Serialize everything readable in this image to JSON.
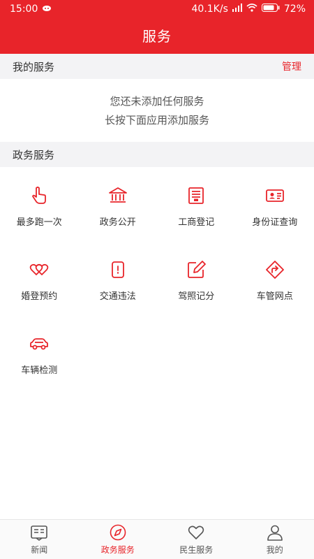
{
  "status": {
    "time": "15:00",
    "speed": "40.1K/s",
    "battery": "72%"
  },
  "header": {
    "title": "服务"
  },
  "my_services": {
    "title": "我的服务",
    "manage": "管理",
    "empty_line1": "您还未添加任何服务",
    "empty_line2": "长按下面应用添加服务"
  },
  "gov_services": {
    "title": "政务服务",
    "items": [
      {
        "label": "最多跑一次",
        "icon": "hand-pointer-icon"
      },
      {
        "label": "政务公开",
        "icon": "government-building-icon"
      },
      {
        "label": "工商登记",
        "icon": "business-license-icon"
      },
      {
        "label": "身份证查询",
        "icon": "id-card-icon"
      },
      {
        "label": "婚登预约",
        "icon": "linked-hearts-icon"
      },
      {
        "label": "交通违法",
        "icon": "traffic-violation-icon"
      },
      {
        "label": "驾照记分",
        "icon": "edit-pen-icon"
      },
      {
        "label": "车管网点",
        "icon": "direction-sign-icon"
      },
      {
        "label": "车辆检测",
        "icon": "car-icon"
      }
    ]
  },
  "tabs": [
    {
      "label": "新闻",
      "icon": "newspaper-icon"
    },
    {
      "label": "政务服务",
      "icon": "compass-icon",
      "active": true
    },
    {
      "label": "民生服务",
      "icon": "heart-icon"
    },
    {
      "label": "我的",
      "icon": "user-icon"
    }
  ],
  "colors": {
    "accent": "#e8242a"
  }
}
